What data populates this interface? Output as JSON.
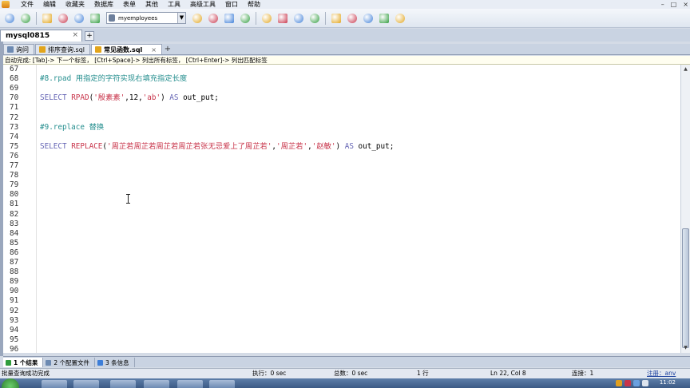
{
  "menubar": {
    "items": [
      "文件",
      "编辑",
      "收藏夹",
      "数据库",
      "表单",
      "其他",
      "工具",
      "高级工具",
      "窗口",
      "帮助"
    ],
    "window_controls": [
      "–",
      "□",
      "×"
    ]
  },
  "toolbar": {
    "database_selector": "myemployees",
    "icons": [
      "new-connection-icon",
      "new-query-icon",
      "execute-icon",
      "execute-all-icon",
      "stop-icon",
      "refresh-icon",
      "schema-icon",
      "table-icon",
      "import-icon",
      "export-icon",
      "backup-icon",
      "restore-icon",
      "users-icon",
      "sync-icon",
      "schedule-icon",
      "designer-icon",
      "compare-icon",
      "monitor-icon",
      "format-icon"
    ],
    "accent_colors": [
      "#3d7ed8",
      "#2f9c3c",
      "#e2a51c",
      "#c8344a"
    ]
  },
  "connection_tab": {
    "label": "mysql0815",
    "close": "×",
    "add": "+"
  },
  "editor_tabs": [
    {
      "label": "询问",
      "icon": "query-icon",
      "active": false,
      "close": ""
    },
    {
      "label": "排序查询.sql",
      "icon": "sql-file-icon",
      "active": false,
      "close": ""
    },
    {
      "label": "常见函数.sql",
      "icon": "sql-file-icon",
      "active": true,
      "close": "×"
    }
  ],
  "editor_tab_add": "+",
  "hint_bar": {
    "text": "自动完成: [Tab]-> 下一个标签， [Ctrl+Space]-> 列出所有标签， [Ctrl+Enter]-> 列出匹配标签"
  },
  "editor": {
    "lines": [
      {
        "n": "67",
        "tokens": []
      },
      {
        "n": "68",
        "tokens": [
          {
            "t": "#8.rpad 用指定的字符实现右填充指定长度",
            "c": "cm"
          }
        ]
      },
      {
        "n": "69",
        "tokens": []
      },
      {
        "n": "70",
        "tokens": [
          {
            "t": "SELECT ",
            "c": "kw"
          },
          {
            "t": "RPAD",
            "c": "fn"
          },
          {
            "t": "(",
            "c": "pl"
          },
          {
            "t": "'殷素素'",
            "c": "str"
          },
          {
            "t": ",12,",
            "c": "pl"
          },
          {
            "t": "'ab'",
            "c": "str"
          },
          {
            "t": ") ",
            "c": "pl"
          },
          {
            "t": "AS",
            "c": "kw"
          },
          {
            "t": " out_put;",
            "c": "pl"
          }
        ]
      },
      {
        "n": "71",
        "tokens": []
      },
      {
        "n": "72",
        "tokens": []
      },
      {
        "n": "73",
        "tokens": [
          {
            "t": "#9.replace 替换",
            "c": "cm"
          }
        ]
      },
      {
        "n": "74",
        "tokens": []
      },
      {
        "n": "75",
        "tokens": [
          {
            "t": "SELECT ",
            "c": "kw"
          },
          {
            "t": "REPLACE",
            "c": "fn"
          },
          {
            "t": "(",
            "c": "pl"
          },
          {
            "t": "'周芷若周芷若周芷若周芷若张无忌爱上了周芷若'",
            "c": "str"
          },
          {
            "t": ",",
            "c": "pl"
          },
          {
            "t": "'周芷若'",
            "c": "str"
          },
          {
            "t": ",",
            "c": "pl"
          },
          {
            "t": "'赵敏'",
            "c": "str"
          },
          {
            "t": ") ",
            "c": "pl"
          },
          {
            "t": "AS",
            "c": "kw"
          },
          {
            "t": " out_put;",
            "c": "pl"
          }
        ]
      },
      {
        "n": "76",
        "tokens": []
      },
      {
        "n": "77",
        "tokens": []
      },
      {
        "n": "78",
        "tokens": []
      },
      {
        "n": "79",
        "tokens": []
      },
      {
        "n": "80",
        "tokens": []
      },
      {
        "n": "81",
        "tokens": []
      },
      {
        "n": "82",
        "tokens": []
      },
      {
        "n": "83",
        "tokens": []
      },
      {
        "n": "84",
        "tokens": []
      },
      {
        "n": "85",
        "tokens": []
      },
      {
        "n": "86",
        "tokens": []
      },
      {
        "n": "87",
        "tokens": []
      },
      {
        "n": "88",
        "tokens": []
      },
      {
        "n": "89",
        "tokens": []
      },
      {
        "n": "90",
        "tokens": []
      },
      {
        "n": "91",
        "tokens": []
      },
      {
        "n": "92",
        "tokens": []
      },
      {
        "n": "93",
        "tokens": []
      },
      {
        "n": "94",
        "tokens": []
      },
      {
        "n": "95",
        "tokens": []
      },
      {
        "n": "96",
        "tokens": []
      }
    ],
    "colors": {
      "keyword": "#6464b4",
      "function": "#c8344a",
      "string": "#c8344a",
      "comment": "#268f8f"
    }
  },
  "result_tabs": [
    {
      "label": "1 个结果",
      "icon": "grid-icon",
      "active": true
    },
    {
      "label": "2 个配置文件",
      "icon": "profile-icon",
      "active": false
    },
    {
      "label": "3 条信息",
      "icon": "info-icon",
      "active": false
    }
  ],
  "statusbar": {
    "message": "批量查询成功完成",
    "exec_time": "执行：0 sec",
    "total_time": "总数：0 sec",
    "rows": "1 行",
    "position": "Ln 22, Col 8",
    "connections": "连接：1",
    "user": "注册：anv"
  },
  "taskbar": {
    "clock": "11:02"
  }
}
